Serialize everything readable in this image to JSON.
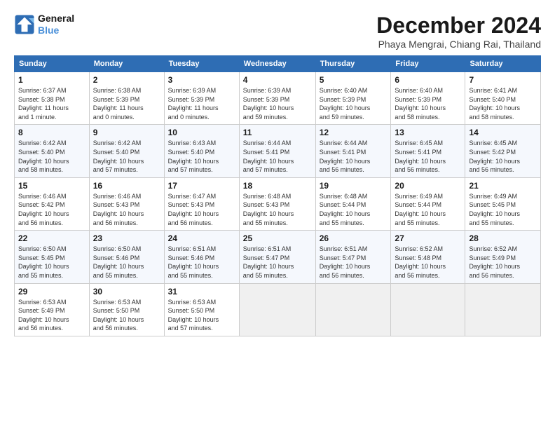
{
  "logo": {
    "line1": "General",
    "line2": "Blue"
  },
  "header": {
    "month": "December 2024",
    "location": "Phaya Mengrai, Chiang Rai, Thailand"
  },
  "weekdays": [
    "Sunday",
    "Monday",
    "Tuesday",
    "Wednesday",
    "Thursday",
    "Friday",
    "Saturday"
  ],
  "weeks": [
    [
      {
        "day": "1",
        "info": "Sunrise: 6:37 AM\nSunset: 5:38 PM\nDaylight: 11 hours\nand 1 minute."
      },
      {
        "day": "2",
        "info": "Sunrise: 6:38 AM\nSunset: 5:39 PM\nDaylight: 11 hours\nand 0 minutes."
      },
      {
        "day": "3",
        "info": "Sunrise: 6:39 AM\nSunset: 5:39 PM\nDaylight: 11 hours\nand 0 minutes."
      },
      {
        "day": "4",
        "info": "Sunrise: 6:39 AM\nSunset: 5:39 PM\nDaylight: 10 hours\nand 59 minutes."
      },
      {
        "day": "5",
        "info": "Sunrise: 6:40 AM\nSunset: 5:39 PM\nDaylight: 10 hours\nand 59 minutes."
      },
      {
        "day": "6",
        "info": "Sunrise: 6:40 AM\nSunset: 5:39 PM\nDaylight: 10 hours\nand 58 minutes."
      },
      {
        "day": "7",
        "info": "Sunrise: 6:41 AM\nSunset: 5:40 PM\nDaylight: 10 hours\nand 58 minutes."
      }
    ],
    [
      {
        "day": "8",
        "info": "Sunrise: 6:42 AM\nSunset: 5:40 PM\nDaylight: 10 hours\nand 58 minutes."
      },
      {
        "day": "9",
        "info": "Sunrise: 6:42 AM\nSunset: 5:40 PM\nDaylight: 10 hours\nand 57 minutes."
      },
      {
        "day": "10",
        "info": "Sunrise: 6:43 AM\nSunset: 5:40 PM\nDaylight: 10 hours\nand 57 minutes."
      },
      {
        "day": "11",
        "info": "Sunrise: 6:44 AM\nSunset: 5:41 PM\nDaylight: 10 hours\nand 57 minutes."
      },
      {
        "day": "12",
        "info": "Sunrise: 6:44 AM\nSunset: 5:41 PM\nDaylight: 10 hours\nand 56 minutes."
      },
      {
        "day": "13",
        "info": "Sunrise: 6:45 AM\nSunset: 5:41 PM\nDaylight: 10 hours\nand 56 minutes."
      },
      {
        "day": "14",
        "info": "Sunrise: 6:45 AM\nSunset: 5:42 PM\nDaylight: 10 hours\nand 56 minutes."
      }
    ],
    [
      {
        "day": "15",
        "info": "Sunrise: 6:46 AM\nSunset: 5:42 PM\nDaylight: 10 hours\nand 56 minutes."
      },
      {
        "day": "16",
        "info": "Sunrise: 6:46 AM\nSunset: 5:43 PM\nDaylight: 10 hours\nand 56 minutes."
      },
      {
        "day": "17",
        "info": "Sunrise: 6:47 AM\nSunset: 5:43 PM\nDaylight: 10 hours\nand 56 minutes."
      },
      {
        "day": "18",
        "info": "Sunrise: 6:48 AM\nSunset: 5:43 PM\nDaylight: 10 hours\nand 55 minutes."
      },
      {
        "day": "19",
        "info": "Sunrise: 6:48 AM\nSunset: 5:44 PM\nDaylight: 10 hours\nand 55 minutes."
      },
      {
        "day": "20",
        "info": "Sunrise: 6:49 AM\nSunset: 5:44 PM\nDaylight: 10 hours\nand 55 minutes."
      },
      {
        "day": "21",
        "info": "Sunrise: 6:49 AM\nSunset: 5:45 PM\nDaylight: 10 hours\nand 55 minutes."
      }
    ],
    [
      {
        "day": "22",
        "info": "Sunrise: 6:50 AM\nSunset: 5:45 PM\nDaylight: 10 hours\nand 55 minutes."
      },
      {
        "day": "23",
        "info": "Sunrise: 6:50 AM\nSunset: 5:46 PM\nDaylight: 10 hours\nand 55 minutes."
      },
      {
        "day": "24",
        "info": "Sunrise: 6:51 AM\nSunset: 5:46 PM\nDaylight: 10 hours\nand 55 minutes."
      },
      {
        "day": "25",
        "info": "Sunrise: 6:51 AM\nSunset: 5:47 PM\nDaylight: 10 hours\nand 55 minutes."
      },
      {
        "day": "26",
        "info": "Sunrise: 6:51 AM\nSunset: 5:47 PM\nDaylight: 10 hours\nand 56 minutes."
      },
      {
        "day": "27",
        "info": "Sunrise: 6:52 AM\nSunset: 5:48 PM\nDaylight: 10 hours\nand 56 minutes."
      },
      {
        "day": "28",
        "info": "Sunrise: 6:52 AM\nSunset: 5:49 PM\nDaylight: 10 hours\nand 56 minutes."
      }
    ],
    [
      {
        "day": "29",
        "info": "Sunrise: 6:53 AM\nSunset: 5:49 PM\nDaylight: 10 hours\nand 56 minutes."
      },
      {
        "day": "30",
        "info": "Sunrise: 6:53 AM\nSunset: 5:50 PM\nDaylight: 10 hours\nand 56 minutes."
      },
      {
        "day": "31",
        "info": "Sunrise: 6:53 AM\nSunset: 5:50 PM\nDaylight: 10 hours\nand 57 minutes."
      },
      {
        "day": "",
        "info": ""
      },
      {
        "day": "",
        "info": ""
      },
      {
        "day": "",
        "info": ""
      },
      {
        "day": "",
        "info": ""
      }
    ]
  ]
}
